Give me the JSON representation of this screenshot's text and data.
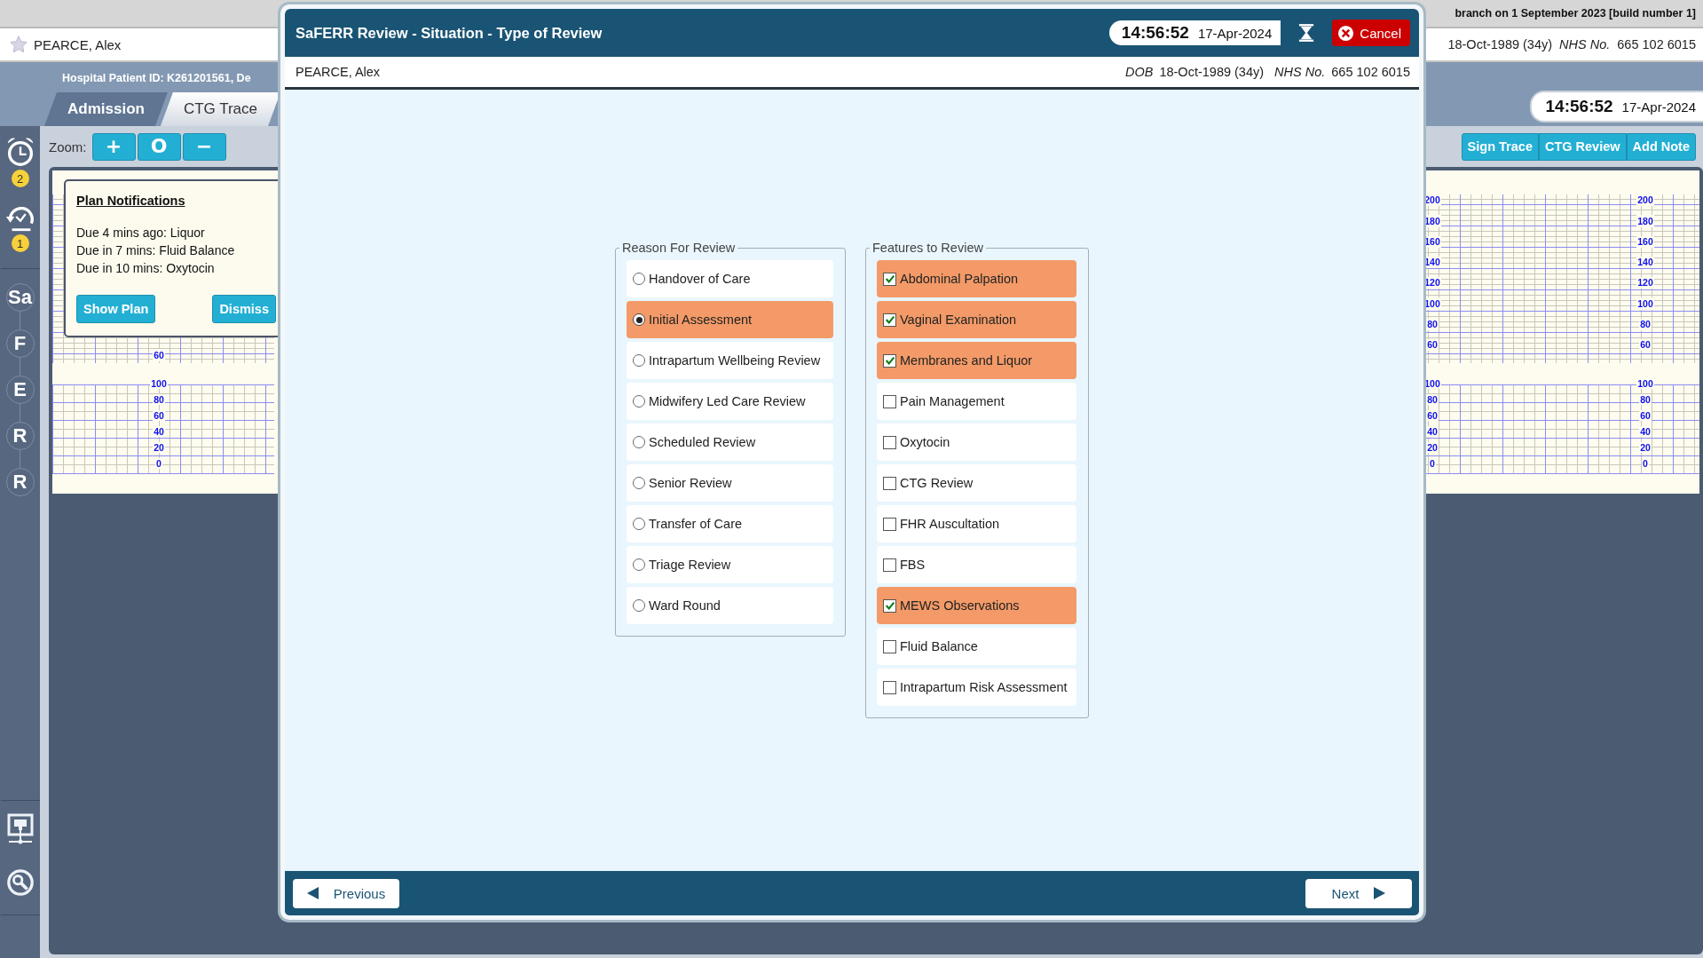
{
  "build_info": "branch on 1 September 2023 [build number 1]",
  "patient_bar": {
    "name": "PEARCE, Alex",
    "dob": "18-Oct-1989 (34y)",
    "nhs_label": "NHS No.",
    "nhs_number": "665 102 6015"
  },
  "header": {
    "hospital_id": "Hospital Patient ID: K261201561, De",
    "clock": {
      "time": "14:56:52",
      "date": "17-Apr-2024"
    }
  },
  "tabs": [
    {
      "label": "Admission",
      "selected": false
    },
    {
      "label": "CTG Trace",
      "selected": true
    }
  ],
  "sidebar": {
    "alerts": [
      {
        "kind": "alarm",
        "badge": "2"
      },
      {
        "kind": "history",
        "badge": "1"
      }
    ],
    "stages": [
      "Sa",
      "F",
      "E",
      "R",
      "R"
    ],
    "tools": [
      {
        "kind": "network"
      },
      {
        "kind": "search"
      }
    ]
  },
  "toolbar": {
    "zoom_label": "Zoom:",
    "zoom_buttons": [
      "+",
      "O",
      "−"
    ],
    "actions": [
      "Sign Trace",
      "CTG Review",
      "Add Note"
    ]
  },
  "trace": {
    "left_scales": [
      {
        "fhr_labels": [
          "60"
        ],
        "toco_labels": [
          "100",
          "80",
          "60",
          "40",
          "20",
          "0"
        ]
      }
    ],
    "right_scales": [
      {
        "fhr_labels": [
          "200",
          "180",
          "160",
          "140",
          "120",
          "100",
          "80",
          "60"
        ],
        "toco_labels": [
          "100",
          "80",
          "60",
          "40",
          "20",
          "0"
        ]
      },
      {
        "fhr_labels": [
          "200",
          "180",
          "160",
          "140",
          "120",
          "100",
          "80",
          "60"
        ],
        "toco_labels": [
          "100",
          "80",
          "60",
          "40",
          "20",
          "0"
        ]
      }
    ]
  },
  "notification": {
    "title": "Plan Notifications",
    "lines": [
      "Due 4 mins ago: Liquor",
      "Due in 7 mins: Fluid Balance",
      "Due in 10 mins: Oxytocin"
    ],
    "buttons": [
      "Show Plan",
      "Dismiss"
    ]
  },
  "dialog": {
    "title": "SaFERR Review - Situation - Type of Review",
    "clock": {
      "time": "14:56:52",
      "date": "17-Apr-2024"
    },
    "cancel": "Cancel",
    "patient": {
      "name": "PEARCE, Alex",
      "dob_label": "DOB",
      "dob": "18-Oct-1989 (34y)",
      "nhs_label": "NHS No.",
      "nhs_number": "665 102 6015"
    },
    "reason": {
      "legend": "Reason For Review",
      "options": [
        {
          "label": "Handover of Care",
          "selected": false
        },
        {
          "label": "Initial Assessment",
          "selected": true
        },
        {
          "label": "Intrapartum Wellbeing Review",
          "selected": false
        },
        {
          "label": "Midwifery Led Care Review",
          "selected": false
        },
        {
          "label": "Scheduled Review",
          "selected": false
        },
        {
          "label": "Senior Review",
          "selected": false
        },
        {
          "label": "Transfer of Care",
          "selected": false
        },
        {
          "label": "Triage Review",
          "selected": false
        },
        {
          "label": "Ward Round",
          "selected": false
        }
      ]
    },
    "features": {
      "legend": "Features to Review",
      "options": [
        {
          "label": "Abdominal Palpation",
          "checked": true
        },
        {
          "label": "Vaginal Examination",
          "checked": true
        },
        {
          "label": "Membranes and Liquor",
          "checked": true
        },
        {
          "label": "Pain Management",
          "checked": false
        },
        {
          "label": "Oxytocin",
          "checked": false
        },
        {
          "label": "CTG Review",
          "checked": false
        },
        {
          "label": "FHR Auscultation",
          "checked": false
        },
        {
          "label": "FBS",
          "checked": false
        },
        {
          "label": "MEWS Observations",
          "checked": true
        },
        {
          "label": "Fluid Balance",
          "checked": false
        },
        {
          "label": "Intrapartum Risk Assessment",
          "checked": false
        }
      ]
    },
    "previous": "Previous",
    "next": "Next"
  }
}
